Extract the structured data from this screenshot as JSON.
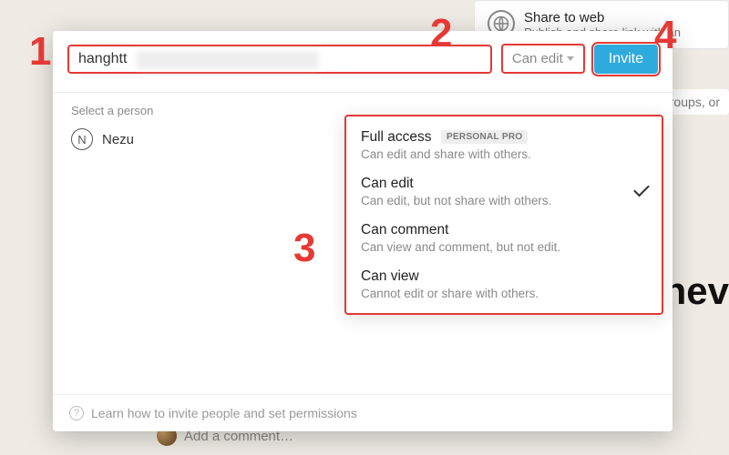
{
  "background": {
    "share_title": "Share to web",
    "share_sub": "Publish and share link with an",
    "more_text": "groups, or",
    "comment_placeholder": "Add a comment…",
    "nev": "nev"
  },
  "modal": {
    "search_value": "hanghtt",
    "perm_label": "Can edit",
    "invite_label": "Invite",
    "section_label": "Select a person",
    "person": {
      "initial": "N",
      "name": "Nezu"
    },
    "footer": "Learn how to invite people and set permissions"
  },
  "dropdown": {
    "items": [
      {
        "title": "Full access",
        "badge": "PERSONAL PRO",
        "desc": "Can edit and share with others.",
        "selected": false
      },
      {
        "title": "Can edit",
        "badge": "",
        "desc": "Can edit, but not share with others.",
        "selected": true
      },
      {
        "title": "Can comment",
        "badge": "",
        "desc": "Can view and comment, but not edit.",
        "selected": false
      },
      {
        "title": "Can view",
        "badge": "",
        "desc": "Cannot edit or share with others.",
        "selected": false
      }
    ]
  },
  "annotations": {
    "1": "1",
    "2": "2",
    "3": "3",
    "4": "4"
  }
}
